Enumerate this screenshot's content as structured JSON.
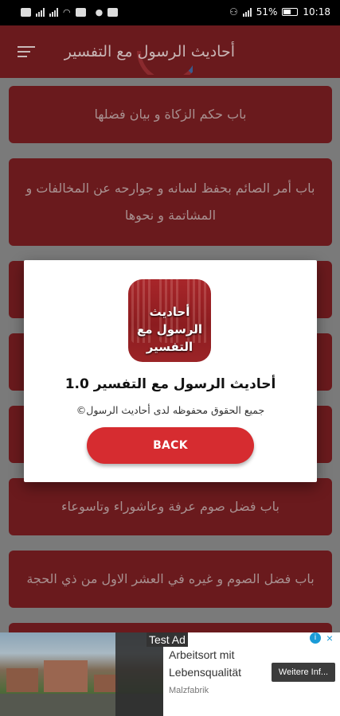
{
  "status_bar": {
    "battery": "51%",
    "time": "10:18"
  },
  "app_bar": {
    "title": "أحاديث الرسول مع التفسير"
  },
  "list": {
    "items": [
      {
        "label": "باب حكم الزكاة و بيان فضلها"
      },
      {
        "label": "باب أمر الصائم بحفظ لسانه و جوارحه عن المخالفات و المشاتمة و نحوها"
      },
      {
        "label": ""
      },
      {
        "label": ""
      },
      {
        "label": ""
      },
      {
        "label": "باب فضل صوم عرفة وعاشوراء وتاسوعاء"
      },
      {
        "label": "باب فضل الصوم و غيره في العشر الاول من ذي الحجة"
      },
      {
        "label": ""
      }
    ]
  },
  "dialog": {
    "icon_text": "أحاديث الرسول مع التفسير",
    "title": "أحاديث الرسول مع التفسير 1.0",
    "copyright": "جميع الحقوق محفوظه لدى أحاديث الرسول©",
    "back_label": "BACK"
  },
  "ad": {
    "label": "Test Ad",
    "headline": "Arbeitsort mit Lebensqualität",
    "source": "Malzfabrik",
    "cta": "Weitere Inf...",
    "info_icon": "i",
    "close_icon": "×"
  }
}
